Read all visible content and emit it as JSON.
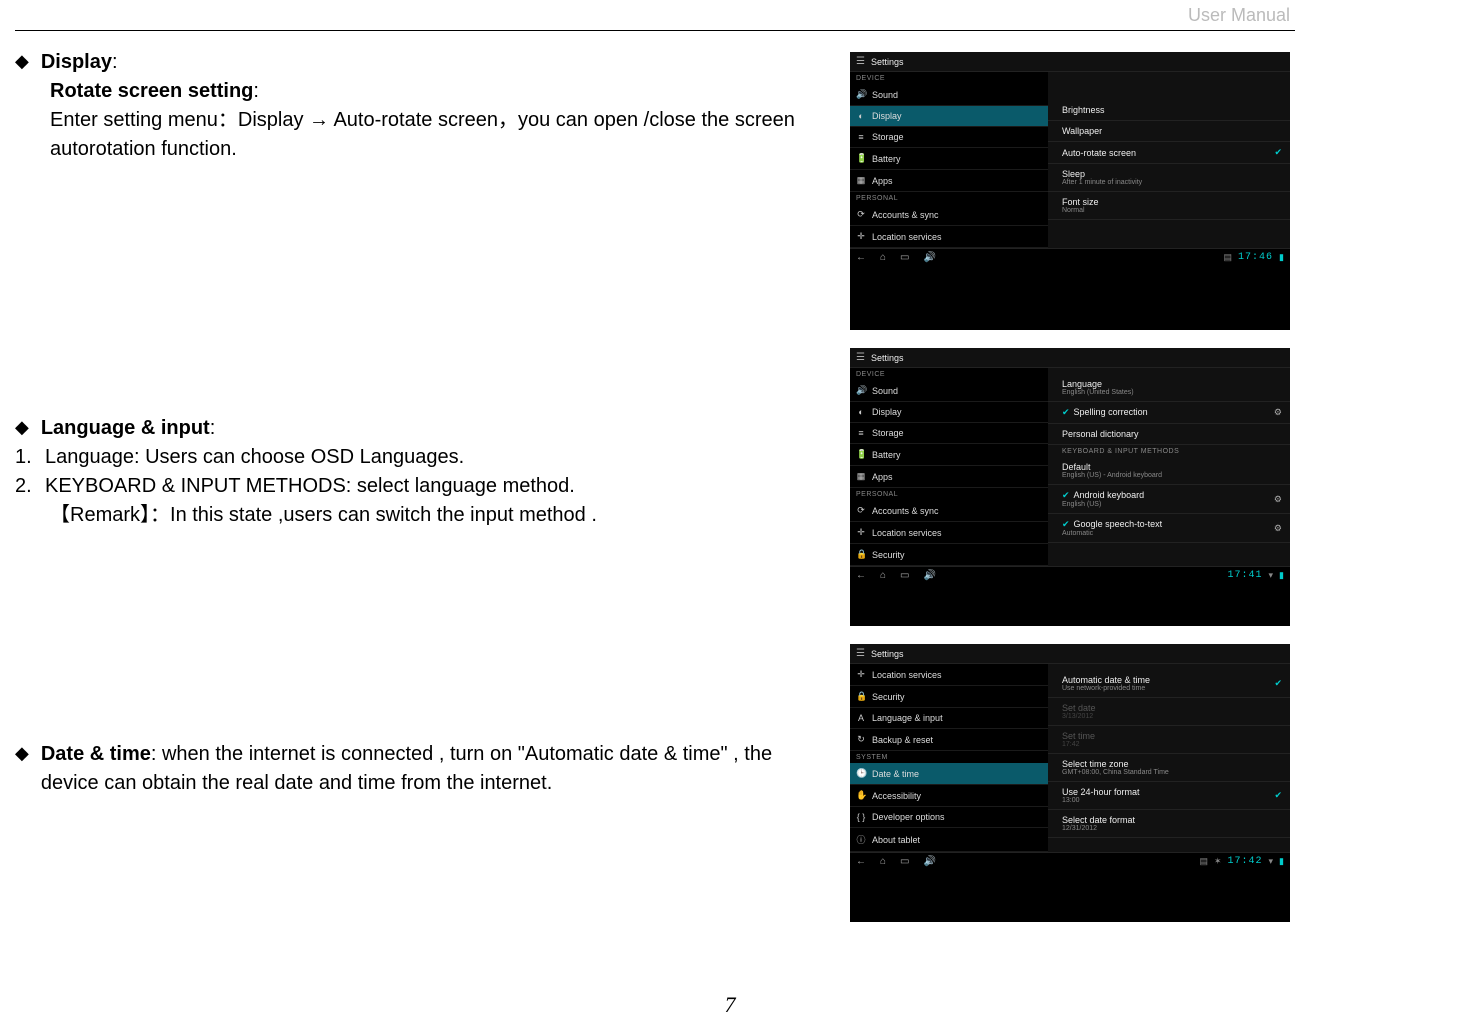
{
  "header": {
    "label": "User Manual"
  },
  "page_number": "7",
  "text": {
    "display": {
      "title": "Display",
      "subtitle": "Rotate screen setting",
      "body_1": "Enter setting menu：Display ",
      "body_2": " Auto-rotate screen，you can open /close the screen autorotation function."
    },
    "language": {
      "title": "Language & input",
      "item1": "Language: Users can choose OSD Languages.",
      "item2": "KEYBOARD & INPUT METHODS: select language method.",
      "remark": "【Remark】：In this state ,users can switch the input method ."
    },
    "datetime": {
      "title": "Date & time",
      "body": ": when the internet is connected , turn on \"Automatic date & time\" , the device can obtain the real date and time from the internet."
    }
  },
  "shot1": {
    "title": "Settings",
    "cat1": "DEVICE",
    "left": [
      "Sound",
      "Display",
      "Storage",
      "Battery",
      "Apps"
    ],
    "cat2": "PERSONAL",
    "left2": [
      "Accounts & sync",
      "Location services"
    ],
    "right": [
      {
        "label": "Brightness"
      },
      {
        "label": "Wallpaper"
      },
      {
        "label": "Auto-rotate screen",
        "check": true
      },
      {
        "label": "Sleep",
        "sub": "After 1 minute of inactivity"
      },
      {
        "label": "Font size",
        "sub": "Normal"
      }
    ],
    "time": "17:46"
  },
  "shot2": {
    "title": "Settings",
    "cat1": "DEVICE",
    "left": [
      "Sound",
      "Display",
      "Storage",
      "Battery",
      "Apps"
    ],
    "cat2": "PERSONAL",
    "left2": [
      "Accounts & sync",
      "Location services",
      "Security"
    ],
    "right_cat": "KEYBOARD & INPUT METHODS",
    "right": [
      {
        "label": "Language",
        "sub": "English (United States)"
      },
      {
        "label": "Spelling correction",
        "leftcheck": true,
        "tune": true
      },
      {
        "label": "Personal dictionary"
      },
      {
        "label": "Default",
        "sub": "English (US) - Android keyboard"
      },
      {
        "label": "Android keyboard",
        "sub": "English (US)",
        "leftcheck": true,
        "tune": true
      },
      {
        "label": "Google speech-to-text",
        "sub": "Automatic",
        "leftcheck": true,
        "tune": true
      }
    ],
    "time": "17:41"
  },
  "shot3": {
    "title": "Settings",
    "left": [
      "Location services",
      "Security",
      "Language & input",
      "Backup & reset"
    ],
    "cat2": "SYSTEM",
    "left2": [
      "Date & time",
      "Accessibility",
      "Developer options",
      "About tablet"
    ],
    "right": [
      {
        "label": "Automatic date & time",
        "sub": "Use network-provided time",
        "check": true
      },
      {
        "label": "Set date",
        "sub": "3/13/2012",
        "disabled": true
      },
      {
        "label": "Set time",
        "sub": "17:42",
        "disabled": true
      },
      {
        "label": "Select time zone",
        "sub": "GMT+08:00, China Standard Time"
      },
      {
        "label": "Use 24-hour format",
        "sub": "13:00",
        "check": true
      },
      {
        "label": "Select date format",
        "sub": "12/31/2012"
      }
    ],
    "time": "17:42"
  }
}
